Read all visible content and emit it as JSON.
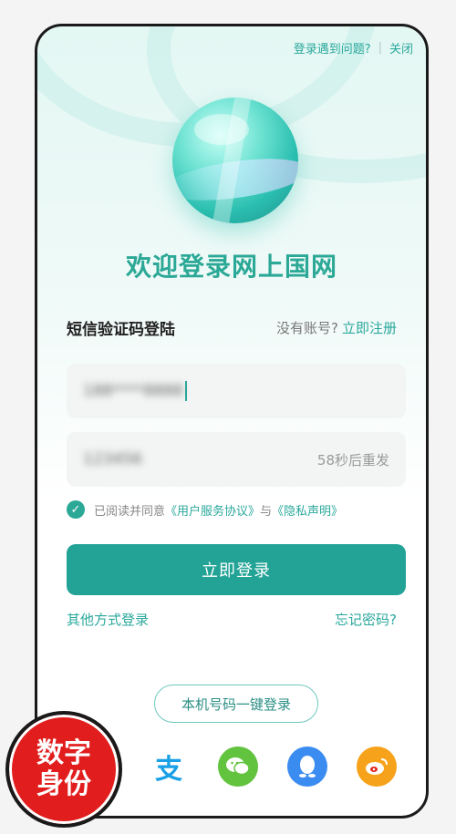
{
  "top": {
    "trouble_link": "登录遇到问题?",
    "close_link": "关闭"
  },
  "header": {
    "title": "欢迎登录网上国网"
  },
  "login": {
    "type_label": "短信验证码登陆",
    "no_account_text": "没有账号?",
    "register_link": "立即注册",
    "phone_value": "188****8888",
    "code_value": "123456",
    "resend_label": "58秒后重发"
  },
  "agreement": {
    "prefix": "已阅读并同意",
    "service_link": "《用户服务协议》",
    "and": "与",
    "privacy_link": "《隐私声明》",
    "checked": true
  },
  "actions": {
    "login_button": "立即登录",
    "other_login": "其他方式登录",
    "forgot_password": "忘记密码?",
    "one_key_login": "本机号码一键登录"
  },
  "social": [
    {
      "name": "alipay-icon",
      "glyph": "支",
      "color": "#1aa0e6"
    },
    {
      "name": "wechat-icon",
      "glyph": "●●",
      "color": "#62c33f"
    },
    {
      "name": "qq-icon",
      "glyph": "Q",
      "color": "#3b8cf0"
    },
    {
      "name": "weibo-icon",
      "glyph": "W",
      "color": "#f6a21a"
    }
  ],
  "badge": {
    "line1": "数字",
    "line2": "身份",
    "color": "#e11d1d"
  },
  "colors": {
    "accent": "#22a396",
    "title": "#2ba896"
  }
}
